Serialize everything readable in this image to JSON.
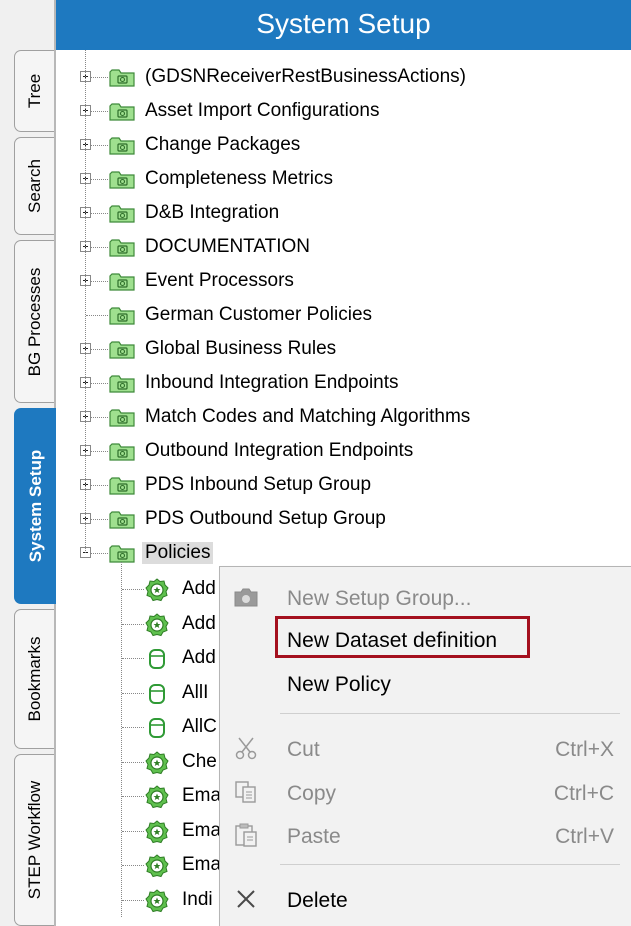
{
  "header": {
    "title": "System Setup"
  },
  "side_tabs": [
    {
      "label": "Tree",
      "active": false
    },
    {
      "label": "Search",
      "active": false
    },
    {
      "label": "BG Processes",
      "active": false
    },
    {
      "label": "System Setup",
      "active": true
    },
    {
      "label": "Bookmarks",
      "active": false
    },
    {
      "label": "STEP Workflow",
      "active": false
    }
  ],
  "tree": {
    "items": [
      {
        "label": "(GDSNReceiverRestBusinessActions)",
        "expander": "plus"
      },
      {
        "label": "Asset Import Configurations",
        "expander": "plus"
      },
      {
        "label": "Change Packages",
        "expander": "plus"
      },
      {
        "label": "Completeness Metrics",
        "expander": "plus"
      },
      {
        "label": "D&B Integration",
        "expander": "plus"
      },
      {
        "label": "DOCUMENTATION",
        "expander": "plus"
      },
      {
        "label": "Event Processors",
        "expander": "plus"
      },
      {
        "label": "German Customer Policies",
        "expander": "none"
      },
      {
        "label": "Global Business Rules",
        "expander": "plus"
      },
      {
        "label": "Inbound Integration Endpoints",
        "expander": "plus"
      },
      {
        "label": "Match Codes and Matching Algorithms",
        "expander": "plus"
      },
      {
        "label": "Outbound Integration Endpoints",
        "expander": "plus"
      },
      {
        "label": "PDS Inbound Setup Group",
        "expander": "plus"
      },
      {
        "label": "PDS Outbound Setup Group",
        "expander": "plus"
      },
      {
        "label": "Policies",
        "expander": "minus",
        "selected": true
      }
    ],
    "children": [
      {
        "label": "Add",
        "icon": "policy-icon"
      },
      {
        "label": "Add",
        "icon": "policy-icon"
      },
      {
        "label": "Add",
        "icon": "dataset-icon"
      },
      {
        "label": "AllI",
        "icon": "dataset-icon"
      },
      {
        "label": "AllC",
        "icon": "dataset-icon"
      },
      {
        "label": "Che",
        "icon": "policy-icon"
      },
      {
        "label": "Ema",
        "icon": "policy-icon"
      },
      {
        "label": "Ema",
        "icon": "policy-icon"
      },
      {
        "label": "Ema",
        "icon": "policy-icon"
      },
      {
        "label": "Indi",
        "icon": "policy-icon"
      }
    ]
  },
  "context_menu": {
    "items": [
      {
        "label": "New Setup Group...",
        "shortcut": "",
        "enabled": false,
        "icon": "camera-icon"
      },
      {
        "label": "New Dataset definition",
        "shortcut": "",
        "enabled": true,
        "icon": "",
        "highlighted": true
      },
      {
        "label": "New Policy",
        "shortcut": "",
        "enabled": true,
        "icon": ""
      },
      {
        "label": "Cut",
        "shortcut": "Ctrl+X",
        "enabled": false,
        "icon": "scissors-icon"
      },
      {
        "label": "Copy",
        "shortcut": "Ctrl+C",
        "enabled": false,
        "icon": "copy-icon"
      },
      {
        "label": "Paste",
        "shortcut": "Ctrl+V",
        "enabled": false,
        "icon": "paste-icon"
      },
      {
        "label": "Delete",
        "shortcut": "",
        "enabled": true,
        "icon": "delete-icon"
      }
    ]
  },
  "colors": {
    "accent": "#1e79c0",
    "highlight_border": "#a4101e",
    "folder": "#7fd17a"
  }
}
